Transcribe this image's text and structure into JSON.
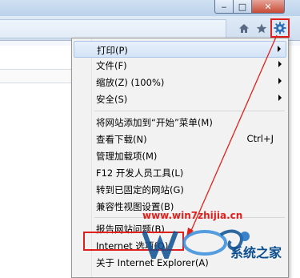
{
  "window_controls": {
    "minimize": "‒",
    "maximize": "□",
    "close": "✕"
  },
  "toolbar": {
    "home_icon": "home-icon",
    "favorites_icon": "star-icon",
    "tools_icon": "gear-icon"
  },
  "menu": {
    "items": [
      {
        "label": "打印(P)",
        "shortcut": "",
        "submenu": true,
        "highlighted": true
      },
      {
        "label": "文件(F)",
        "shortcut": "",
        "submenu": true,
        "highlighted": false
      },
      {
        "label": "缩放(Z) (100%)",
        "shortcut": "",
        "submenu": true,
        "highlighted": false
      },
      {
        "label": "安全(S)",
        "shortcut": "",
        "submenu": true,
        "highlighted": false
      },
      {
        "label": "将网站添加到“开始”菜单(M)",
        "shortcut": "",
        "submenu": false,
        "highlighted": false
      },
      {
        "label": "查看下载(N)",
        "shortcut": "Ctrl+J",
        "submenu": false,
        "highlighted": false
      },
      {
        "label": "管理加载项(M)",
        "shortcut": "",
        "submenu": false,
        "highlighted": false
      },
      {
        "label": "F12 开发人员工具(L)",
        "shortcut": "",
        "submenu": false,
        "highlighted": false
      },
      {
        "label": "转到已固定的网站(G)",
        "shortcut": "",
        "submenu": false,
        "highlighted": false
      },
      {
        "label": "兼容性视图设置(B)",
        "shortcut": "",
        "submenu": false,
        "highlighted": false
      },
      {
        "label": "报告网站问题(B)",
        "shortcut": "",
        "submenu": false,
        "highlighted": false
      },
      {
        "label": "Internet 选项(O)",
        "shortcut": "",
        "submenu": false,
        "highlighted": false
      },
      {
        "label": "关于 Internet Explorer(A)",
        "shortcut": "",
        "submenu": false,
        "highlighted": false
      }
    ]
  },
  "watermark": {
    "url": "www.win7zhijia.cn",
    "brand": "系统之家"
  },
  "colors": {
    "annotation_red": "#e0201c",
    "menu_bg": "#f2f2f2",
    "highlight": "#d3e3f6"
  }
}
